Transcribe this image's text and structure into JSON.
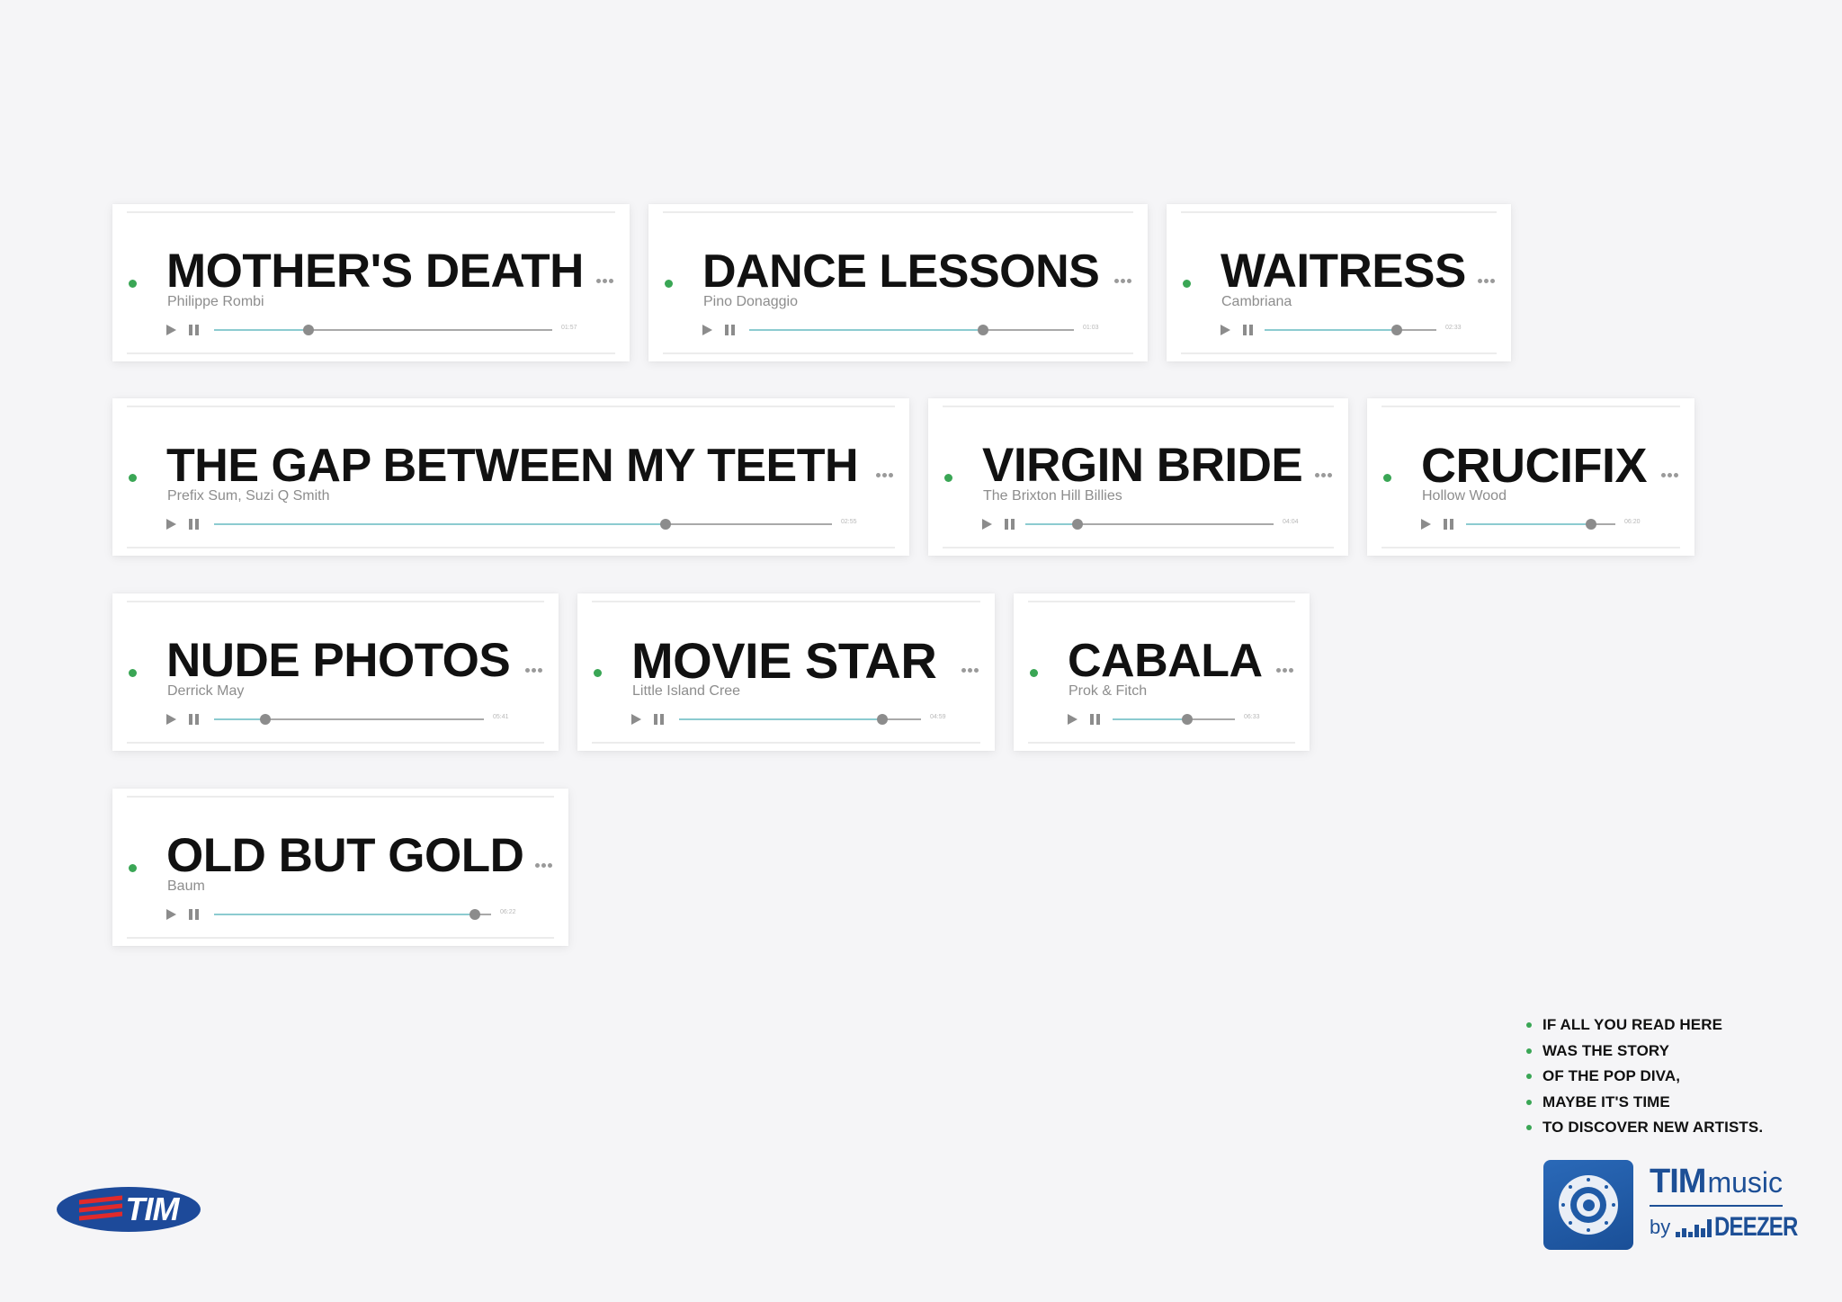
{
  "tracks": [
    {
      "title": "MOTHER'S DEATH",
      "artist": "Philippe Rombi",
      "time": "01:57",
      "progress": 0.28
    },
    {
      "title": "DANCE LESSONS",
      "artist": "Pino Donaggio",
      "time": "01:03",
      "progress": 0.72
    },
    {
      "title": "WAITRESS",
      "artist": "Cambriana",
      "time": "02:33",
      "progress": 0.77
    },
    {
      "title": "THE GAP BETWEEN MY TEETH",
      "artist": "Prefix Sum, Suzi Q Smith",
      "time": "02:55",
      "progress": 0.73
    },
    {
      "title": "VIRGIN BRIDE",
      "artist": "The Brixton Hill Billies",
      "time": "04:04",
      "progress": 0.21
    },
    {
      "title": "CRUCIFIX",
      "artist": "Hollow Wood",
      "time": "06:20",
      "progress": 0.84
    },
    {
      "title": "NUDE PHOTOS",
      "artist": "Derrick May",
      "time": "05:41",
      "progress": 0.19
    },
    {
      "title": "MOVIE STAR",
      "artist": "Little Island Cree",
      "time": "04:59",
      "progress": 0.84
    },
    {
      "title": "CABALA",
      "artist": "Prok & Fitch",
      "time": "06:33",
      "progress": 0.61
    },
    {
      "title": "OLD BUT GOLD",
      "artist": "Baum",
      "time": "06:22",
      "progress": 0.94
    }
  ],
  "tagline": [
    "IF ALL YOU READ HERE",
    "WAS THE STORY",
    "OF THE POP DIVA,",
    "MAYBE IT'S TIME",
    "TO DISCOVER NEW ARTISTS."
  ],
  "logos": {
    "tim": "TIM",
    "tim_music_bold": "TIM",
    "tim_music_light": "music",
    "by": "by",
    "deezer": "DEEZER",
    "app_icon": "speaker-icon"
  },
  "colors": {
    "accent_green": "#3aa655",
    "progress_fill": "#8ccbd0",
    "brand_blue": "#1d4f96",
    "tim_red": "#e12a2a",
    "background": "#f5f5f7"
  }
}
